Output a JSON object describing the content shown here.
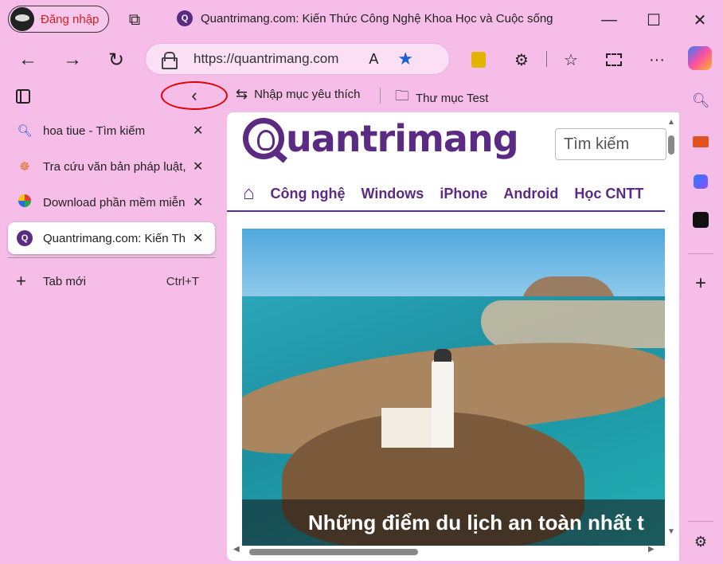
{
  "titlebar": {
    "profile_label": "Đăng nhập",
    "tab_title": "Quantrimang.com: Kiến Thức Công Nghệ Khoa Học và Cuộc sống",
    "minimize": "—",
    "maximize": "☐",
    "close": "✕"
  },
  "toolbar": {
    "back": "←",
    "forward": "→",
    "refresh": "↻",
    "url": "https://quantrimang.com",
    "read_aloud": "A",
    "favorite_star": "★",
    "extensions": "⚙",
    "favorites": "☆",
    "more": "···"
  },
  "favorites_bar": {
    "collapse_glyph": "‹",
    "items": [
      {
        "label": "Nhập mục yêu thích",
        "icon": "import-icon"
      },
      {
        "label": "Thư mục Test",
        "icon": "folder-icon"
      }
    ]
  },
  "tabs": [
    {
      "label": "hoa tiue - Tìm kiếm",
      "icon": "search-icon",
      "close": "✕"
    },
    {
      "label": "Tra cứu văn bản pháp luật,",
      "icon": "wheel-icon",
      "close": "✕"
    },
    {
      "label": "Download phần mềm miễn",
      "icon": "pinwheel-icon",
      "close": "✕"
    },
    {
      "label": "Quantrimang.com: Kiến Thú",
      "icon": "quantrimang-icon",
      "close": "✕"
    }
  ],
  "new_tab": {
    "label": "Tab mới",
    "shortcut": "Ctrl+T"
  },
  "site": {
    "logo_text": "uantrimang",
    "search_placeholder": "Tìm kiếm",
    "menu": [
      "Công nghệ",
      "Windows",
      "iPhone",
      "Android",
      "Học CNTT"
    ],
    "hero_caption": "Những điểm du lịch an toàn nhất t"
  },
  "sidebar_right": [
    "search-icon",
    "toolbox-icon",
    "copilot-icon",
    "chatgpt-icon",
    "add-icon",
    "settings-icon"
  ],
  "colors": {
    "background": "#f6bde9",
    "brand": "#5b2a83",
    "highlight": "#e00000"
  }
}
